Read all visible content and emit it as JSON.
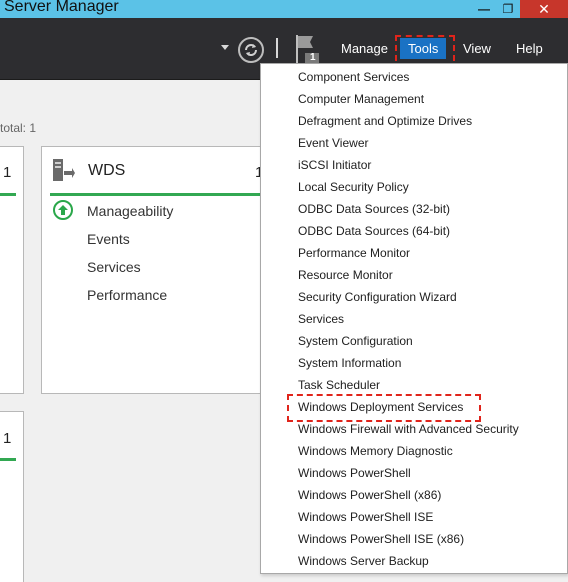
{
  "window": {
    "title": "Server Manager",
    "minimize_symbol": "—",
    "restore_symbol": "❐",
    "close_symbol": "✕"
  },
  "toolbar": {
    "notification_count": "1",
    "menu": [
      {
        "label": "Manage"
      },
      {
        "label": "Tools",
        "active": true
      },
      {
        "label": "View"
      },
      {
        "label": "Help"
      }
    ],
    "accent_color": "#1a72c4"
  },
  "main": {
    "total_text": "total: 1",
    "left_tile_count_top": "1",
    "left_tile_count_bottom": "1",
    "wds_tile": {
      "title": "WDS",
      "count": "1",
      "rows": [
        "Manageability",
        "Events",
        "Services",
        "Performance"
      ],
      "status_color": "#32a852"
    }
  },
  "tools_menu": {
    "items": [
      "Component Services",
      "Computer Management",
      "Defragment and Optimize Drives",
      "Event Viewer",
      "iSCSI Initiator",
      "Local Security Policy",
      "ODBC Data Sources (32-bit)",
      "ODBC Data Sources (64-bit)",
      "Performance Monitor",
      "Resource Monitor",
      "Security Configuration Wizard",
      "Services",
      "System Configuration",
      "System Information",
      "Task Scheduler",
      "Windows Deployment Services",
      "Windows Firewall with Advanced Security",
      "Windows Memory Diagnostic",
      "Windows PowerShell",
      "Windows PowerShell (x86)",
      "Windows PowerShell ISE",
      "Windows PowerShell ISE (x86)",
      "Windows Server Backup"
    ],
    "highlighted_item": "Windows Deployment Services",
    "highlight_color": "#e0241b"
  }
}
